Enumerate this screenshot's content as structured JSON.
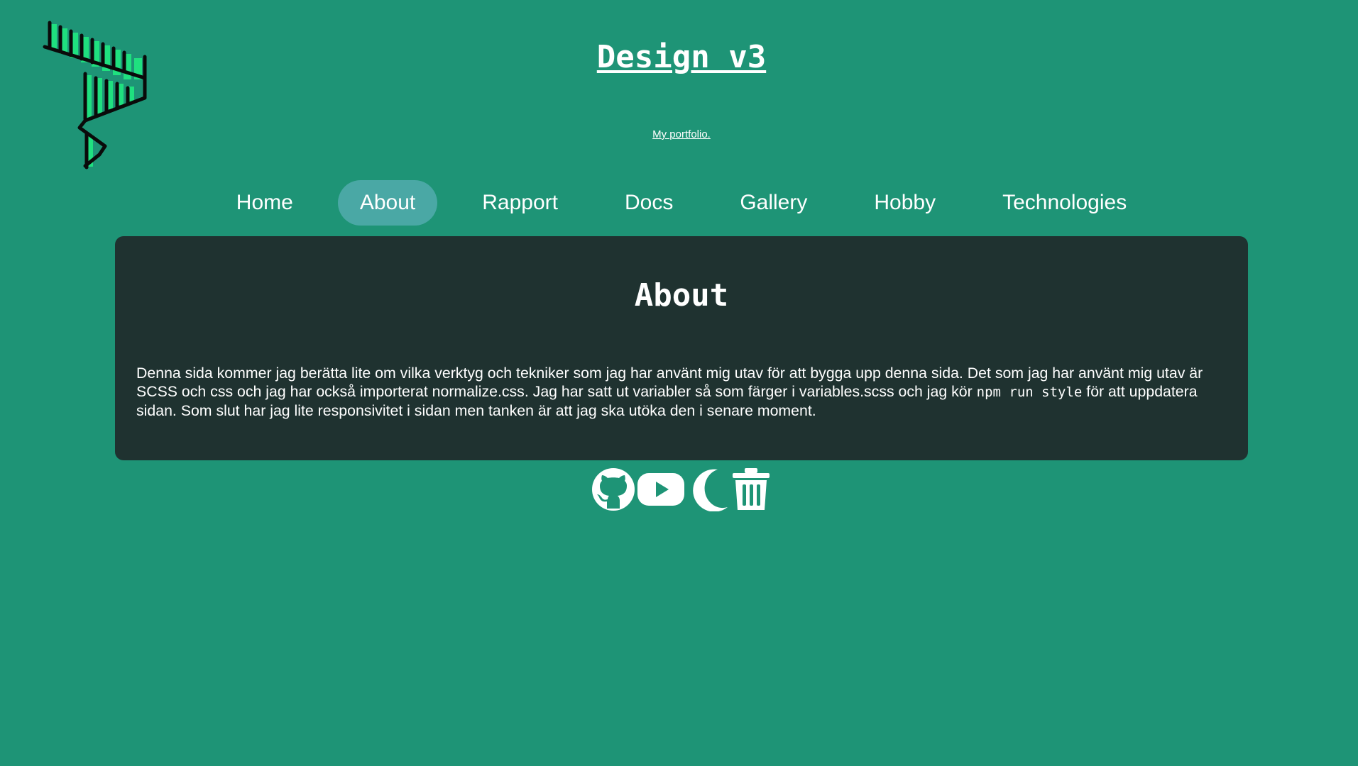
{
  "header": {
    "title": "Design v3",
    "tagline": "My portfolio."
  },
  "nav": {
    "items": [
      {
        "label": "Home"
      },
      {
        "label": "About",
        "active": true
      },
      {
        "label": "Rapport"
      },
      {
        "label": "Docs"
      },
      {
        "label": "Gallery"
      },
      {
        "label": "Hobby"
      },
      {
        "label": "Technologies"
      }
    ]
  },
  "main": {
    "heading": "About",
    "text_before_code": "Denna sida kommer jag berätta lite om vilka verktyg och tekniker som jag har använt mig utav för att bygga upp denna sida. Det som jag har använt mig utav är SCSS och css och jag har också importerat normalize.css. Jag har satt ut variabler så som färger i variables.scss och jag kör ",
    "code": "npm run style",
    "text_after_code": " för att uppdatera sidan. Som slut har jag lite responsivitet i sidan men tanken är att jag ska utöka den i senare moment."
  },
  "footer": {
    "icons": [
      "github-icon",
      "youtube-icon",
      "moon-icon",
      "trash-icon"
    ]
  },
  "colors": {
    "background": "#1e9476",
    "card": "#1f3230",
    "nav_active": "#4aa8a5",
    "text": "#ffffff",
    "logo_green": "#1fe07f"
  }
}
